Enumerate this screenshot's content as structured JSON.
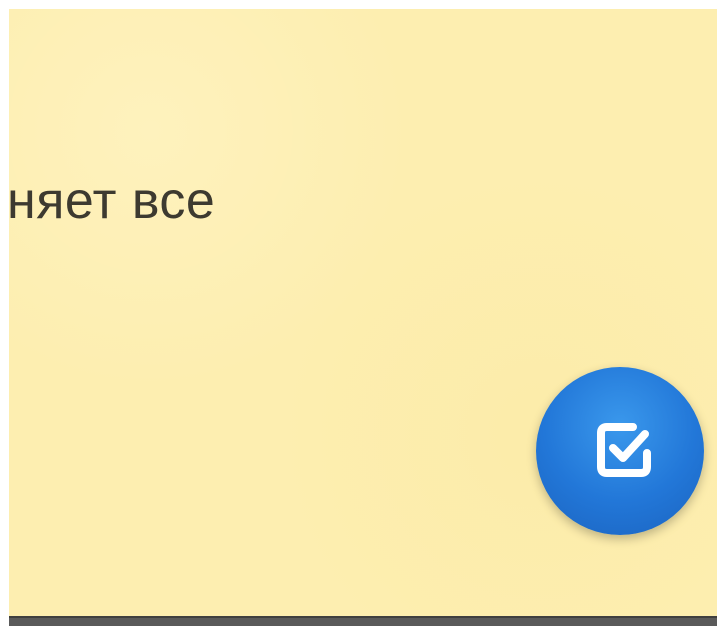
{
  "note": {
    "text": "няет все"
  },
  "fab": {
    "icon": "checkbox-checked-icon",
    "accent": "#2277d8",
    "icon_color": "#ffffff"
  },
  "colors": {
    "note_background": "#fdeeb0",
    "text": "#3d3a30",
    "bottom_bar": "#5a5a5a"
  }
}
